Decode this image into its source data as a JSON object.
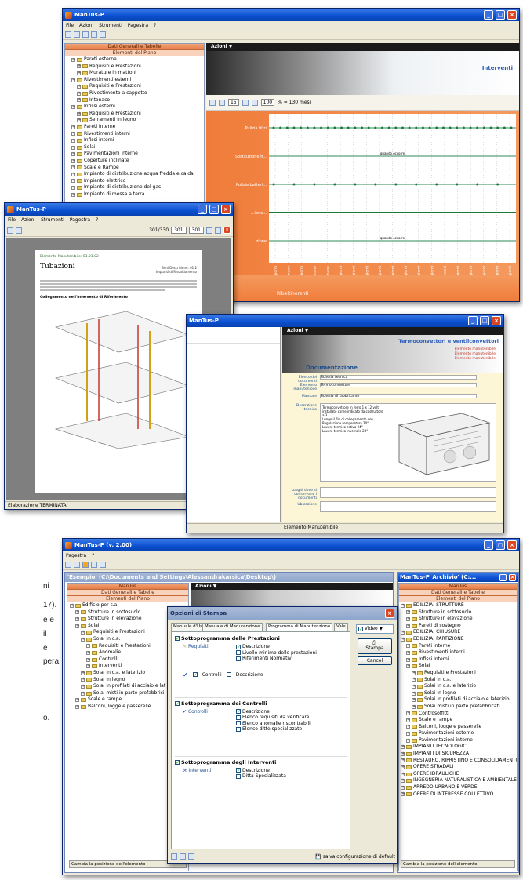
{
  "side_text": [
    "ni",
    "17).",
    "e e",
    "il",
    "e",
    "pera,",
    "o."
  ],
  "win1": {
    "title": "ManTus-P",
    "menu": [
      "File",
      "Azioni",
      "Strumenti",
      "Pagestra",
      "?"
    ],
    "tree_header1": "Dati Generali e Tabelle",
    "tree_header2": "Elementi del Piano",
    "tree": [
      "Pareti esterne",
      "Requisiti e Prestazioni",
      "Murature in mattoni",
      "Rivestimenti esterni",
      "Requisiti e Prestazioni",
      "Rivestimento a cappotto",
      "Intonaco",
      "Infissi esterni",
      "Requisiti e Prestazioni",
      "Serramenti in legno",
      "Pareti interne",
      "Rivestimenti interni",
      "Infissi interni",
      "Solai",
      "Pavimentazioni interne",
      "Coperture inclinate",
      "Scale e Rampe",
      "Impianto di distribuzione acqua fredda e calda",
      "Impianto elettrico",
      "Impianto di distribuzione del gas",
      "Impianto di messa a terra"
    ],
    "actions_label": "Azioni",
    "section_title": "Interventi",
    "zoom": "100",
    "range": "15",
    "months_label": "% = 130 mesi",
    "status": "Ribeltinerenti"
  },
  "chart_data": {
    "type": "scatter",
    "title": "Interventi",
    "rows": [
      "Pulizia filtri",
      "Sostituzione fi...",
      "Pulizia batteri...",
      "...ione...",
      "...zione"
    ],
    "row_annotations": [
      "",
      "quando occorre",
      "",
      "",
      "quando occorre"
    ],
    "x_labels": [
      "61 giorni",
      "21 settimane",
      "424 giorni",
      "26 settimane",
      "183 settimane",
      "855 giorni",
      "1131 giorni",
      "1269 giorni",
      "1522 giorni",
      "1730 giorni",
      "1957 giorni",
      "2051 giorni",
      "2222 giorni",
      "7 mesi",
      "2437 giorni",
      "2617 giorni",
      "2802 giorni",
      "3187 giorni",
      "3246 giorni"
    ],
    "series": [
      {
        "values": [
          1,
          1,
          1,
          1,
          1,
          1,
          1,
          1,
          1,
          1,
          1,
          1,
          1,
          1,
          1,
          1,
          1,
          1,
          1,
          1,
          1,
          1,
          1,
          1,
          1,
          1,
          1,
          1,
          1,
          1,
          1,
          1,
          1,
          1,
          1,
          1
        ]
      },
      {
        "values": [
          1,
          0,
          0,
          1,
          0,
          0,
          1,
          0,
          0,
          1,
          0,
          0,
          1,
          0,
          0,
          1,
          0,
          0,
          1,
          0,
          0,
          1,
          0,
          0,
          1,
          0,
          0,
          1,
          0,
          0,
          1,
          0,
          0,
          1,
          0,
          0
        ]
      }
    ],
    "grid": true,
    "background": "#f49a5e"
  },
  "win2": {
    "title": "ManTus-P",
    "menu": [
      "File",
      "Azioni",
      "Strumenti",
      "Pagestra",
      "?"
    ],
    "page_indicator": "301/330",
    "page_from": "301",
    "page_to": "301",
    "doc_header": "Elemento Manutenibile: 01.21.02",
    "doc_title": "Tubazioni",
    "doc_right1": "Beni Descrizione: 01.2",
    "doc_right2": "Impianti di Riscaldamento",
    "doc_section": "Collegamento nell'Intervento di Riferimento",
    "status": "Elaborazione TERMINATA."
  },
  "win3": {
    "title": "ManTus-P",
    "actions_label": "Azioni",
    "header": "Termoconvettori e ventilconvettori",
    "section": "Documentazione",
    "labels": [
      "Elenco dei documenti",
      "Elemento manutenibile",
      "Manuale",
      "Descrizione tecnica",
      "Luoghi dove si conservano i documenti",
      "Ubicazione"
    ],
    "field_values": [
      "Scheda tecnica",
      "Termoconvettore",
      "Scheda di fabbricante",
      "Termoconvettore in ferro 1 x 12 volt",
      "installato come indicato da costruttore a 3.",
      "Lungo il filo di collegamento con",
      "Regolazione temperatura 20°",
      "Lavoro termico estivo 24°",
      "Lavoro termico invernale 20°"
    ],
    "links": [
      "Elemento manutenibile",
      "Elemento manutenibile",
      "Elemento manutenibile"
    ],
    "footer": "Elemento Manutenibile"
  },
  "win4": {
    "title": "ManTus-P (v. 2.00)",
    "menu": [
      "Pagestra",
      "?"
    ],
    "inner_title": "'Esempio'  (C:\\Documents and Settings\\Alessandrakarsica\\Desktop\\)",
    "panel_labels": [
      "ManTus",
      "Dati Generali e Tabelle",
      "Elementi del Piano"
    ],
    "actions_label": "Azioni",
    "tree": [
      "Edificio per c.a.",
      "Strutture in sottosuolo",
      "Strutture in elevazione",
      "Solai",
      "Requisiti e Prestazioni",
      "Solai in c.a.",
      "Requisiti e Prestazioni",
      "Anomalie",
      "Controlli",
      "Interventi",
      "Solai in c.a. e laterizio",
      "Solai in legno",
      "Solai in profilati di acciaio e lat",
      "Solai misti in parte prefabbrici",
      "Scale e rampe",
      "Balconi, logge e passerelle"
    ],
    "footer": "Cambia la posizione dell'elemento"
  },
  "win5": {
    "title": "ManTus-P_Archivio' (C:...",
    "panel_labels": [
      "ManTus",
      "Dati Generali e Tabelle",
      "Elementi del Piano"
    ],
    "tree": [
      "EDILIZIA: STRUTTURE",
      "Strutture in sottosuolo",
      "Strutture in elevazione",
      "Pareti di sostegno",
      "EDILIZIA: CHIUSURE",
      "EDILIZIA: PARTIZIONE",
      "Pareti interne",
      "Rivestimenti interni",
      "Infissi interni",
      "Solai",
      "Requisiti e Prestazioni",
      "Solai in c.a.",
      "Solai in c.a. e laterizio",
      "Solai in legno",
      "Solai in profilati di acciaio e laterizio",
      "Solai misti in parte prefabbricati",
      "Controsoffitti",
      "Scale e rampe",
      "Balconi, logge e passerelle",
      "Pavimentazioni esterne",
      "Pavimentazioni interne",
      "IMPIANTI TECNOLOGICI",
      "IMPIANTI DI SICUREZZA",
      "RESTAURO, RIPRISTINO E CONSOLIDAMENTO",
      "OPERE STRADALI",
      "OPERE IDRAULICHE",
      "INGEGNERIA NATURALISTICA E AMBIENTALE",
      "ARREDO URBANO E VERDE",
      "OPERE DI INTERESSE COLLETTIVO"
    ],
    "footer": "Cambia la posizione dell'elemento"
  },
  "dialog": {
    "title": "Opzioni di Stampa",
    "tabs": [
      "Manuale d'Uso",
      "Manuale di Manutenzione",
      "Programma di Manutenzione",
      "Vale"
    ],
    "video_label": "Video",
    "print_button": "Stampa",
    "cancel_button": "Cancel",
    "sec1": "Sottoprogramma delle Prestazioni",
    "sec1_icon_label": "Requisiti",
    "sec1_opts": [
      "Descrizione",
      "Livello minimo delle prestazioni",
      "Riferimenti Normativi"
    ],
    "sec1_ctrl_label": "Controlli",
    "sec1_ctrl_opt": "Descrizione",
    "sec2": "Sottoprogramma dei Controlli",
    "sec2_icon_label": "Controlli",
    "sec2_opts": [
      "Descrizione",
      "Elenco requisiti da verificare",
      "Elenco anomalie riscontrabili",
      "Elenco ditte specializzate"
    ],
    "sec3": "Sottoprogramma degli Interventi",
    "sec3_icon_label": "Interventi",
    "sec3_opts": [
      "Descrizione",
      "Ditta Specializzata"
    ],
    "save_label": "salva configurazione di default"
  }
}
